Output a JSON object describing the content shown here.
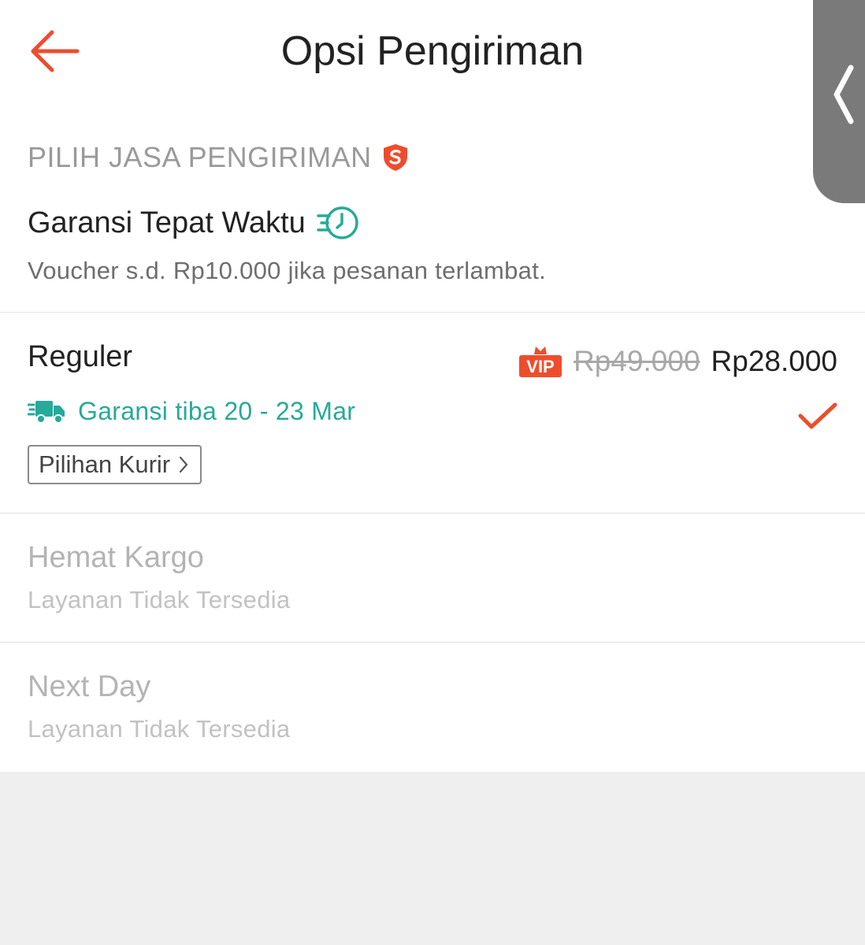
{
  "header": {
    "title": "Opsi Pengiriman",
    "back_icon": "arrow-left-icon"
  },
  "side_handle": {
    "icon": "chevron-left-icon"
  },
  "section": {
    "heading": "PILIH JASA PENGIRIMAN",
    "heading_icon": "shield-s-icon"
  },
  "guarantee": {
    "title": "Garansi Tepat Waktu",
    "icon": "fast-clock-icon",
    "description": "Voucher s.d. Rp10.000 jika pesanan terlambat."
  },
  "options": [
    {
      "name": "Reguler",
      "badge": "VIP",
      "old_price": "Rp49.000",
      "price": "Rp28.000",
      "eta": "Garansi tiba 20 - 23 Mar",
      "eta_icon": "delivery-truck-icon",
      "selected": true,
      "courier_button": "Pilihan Kurir"
    },
    {
      "name": "Hemat Kargo",
      "status": "Layanan Tidak Tersedia"
    },
    {
      "name": "Next Day",
      "status": "Layanan Tidak Tersedia"
    }
  ],
  "colors": {
    "accent": "#ee4d2d",
    "teal": "#26aa99",
    "muted": "#9a9a9a",
    "background": "#efefef"
  }
}
